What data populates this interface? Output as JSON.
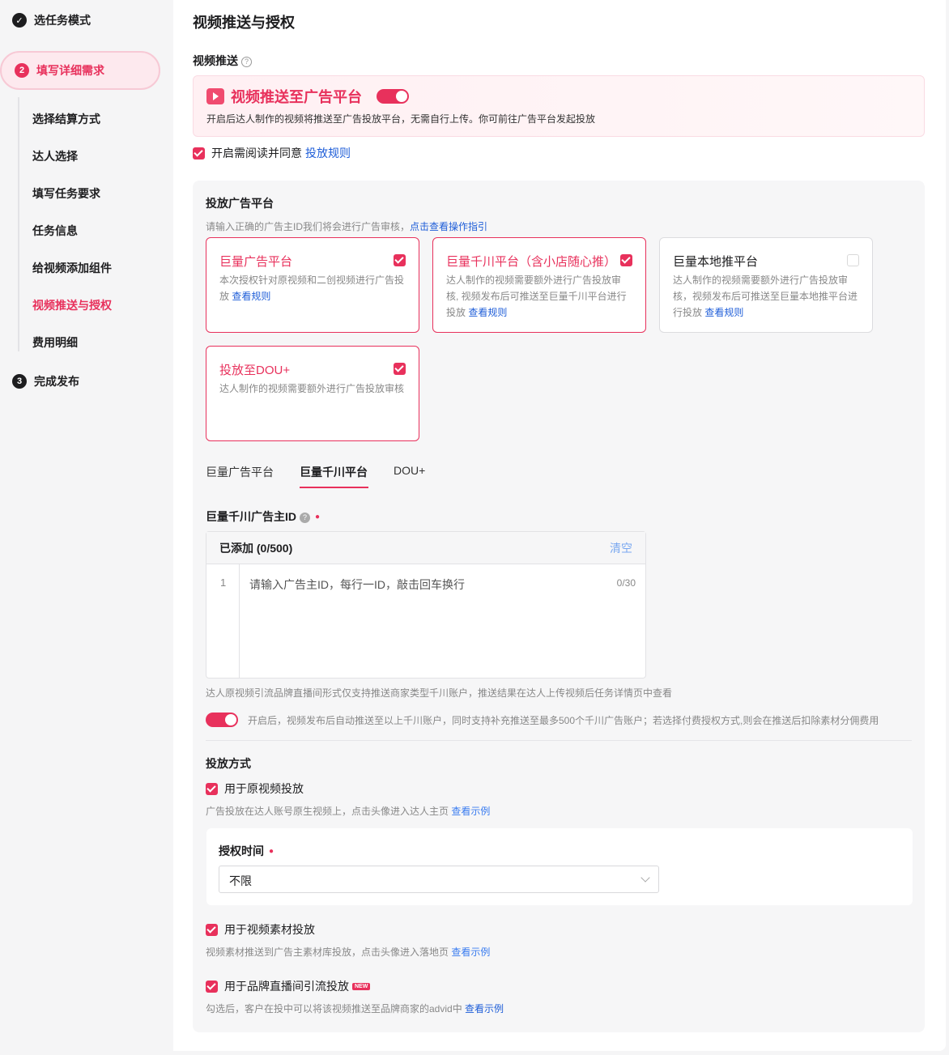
{
  "sidebar": {
    "step1": {
      "label": "选任务模式"
    },
    "step2": {
      "num": "2",
      "label": "填写详细需求"
    },
    "step3": {
      "num": "3",
      "label": "完成发布"
    },
    "subs": [
      "选择结算方式",
      "达人选择",
      "填写任务要求",
      "任务信息",
      "给视频添加组件",
      "视频推送与授权",
      "费用明细"
    ]
  },
  "main": {
    "title": "视频推送与授权",
    "push_label": "视频推送",
    "banner": {
      "title": "视频推送至广告平台",
      "desc": "开启后达人制作的视频将推送至广告投放平台，无需自行上传。你可前往广告平台发起投放"
    },
    "agree": {
      "text": "开启需阅读并同意",
      "link": "投放规则"
    },
    "ad_platform": {
      "title": "投放广告平台",
      "hint": "请输入正确的广告主ID我们将会进行广告审核，",
      "hint_link": "点击查看操作指引",
      "cards": [
        {
          "title": "巨量广告平台",
          "desc": "本次授权针对原视频和二创视频进行广告投放",
          "link": "查看规则",
          "checked": true
        },
        {
          "title": "巨量千川平台（含小店随心推）",
          "desc": "达人制作的视频需要额外进行广告投放审核, 视频发布后可推送至巨量千川平台进行投放",
          "link": "查看规则",
          "checked": true
        },
        {
          "title": "巨量本地推平台",
          "desc": "达人制作的视频需要额外进行广告投放审核，视频发布后可推送至巨量本地推平台进行投放",
          "link": "查看规则",
          "checked": false
        },
        {
          "title": "投放至DOU+",
          "desc": "达人制作的视频需要额外进行广告投放审核",
          "link": "",
          "checked": true
        }
      ]
    },
    "tabs": [
      "巨量广告平台",
      "巨量千川平台",
      "DOU+"
    ],
    "advertiser": {
      "label": "巨量千川广告主ID",
      "added": "已添加 (0/500)",
      "clear": "清空",
      "line": "1",
      "placeholder": "请输入广告主ID，每行一ID，敲击回车换行",
      "count": "0/30",
      "note": "达人原视频引流品牌直播间形式仅支持推送商家类型千川账户，推送结果在达人上传视频后任务详情页中查看",
      "toggle_note": "开启后，视频发布后自动推送至以上千川账户，同时支持补充推送至最多500个千川广告账户；若选择付费授权方式,则会在推送后扣除素材分佣费用"
    },
    "method": {
      "title": "投放方式",
      "opt1": {
        "label": "用于原视频投放",
        "desc": "广告投放在达人账号原生视频上，点击头像进入达人主页",
        "link": "查看示例"
      },
      "auth": {
        "label": "授权时间",
        "value": "不限"
      },
      "opt2": {
        "label": "用于视频素材投放",
        "desc": "视频素材推送到广告主素材库投放，点击头像进入落地页",
        "link": "查看示例"
      },
      "opt3": {
        "label": "用于品牌直播间引流投放",
        "badge": "NEW",
        "desc": "勾选后，客户在投中可以将该视频推送至品牌商家的advid中",
        "link": "查看示例"
      }
    }
  }
}
